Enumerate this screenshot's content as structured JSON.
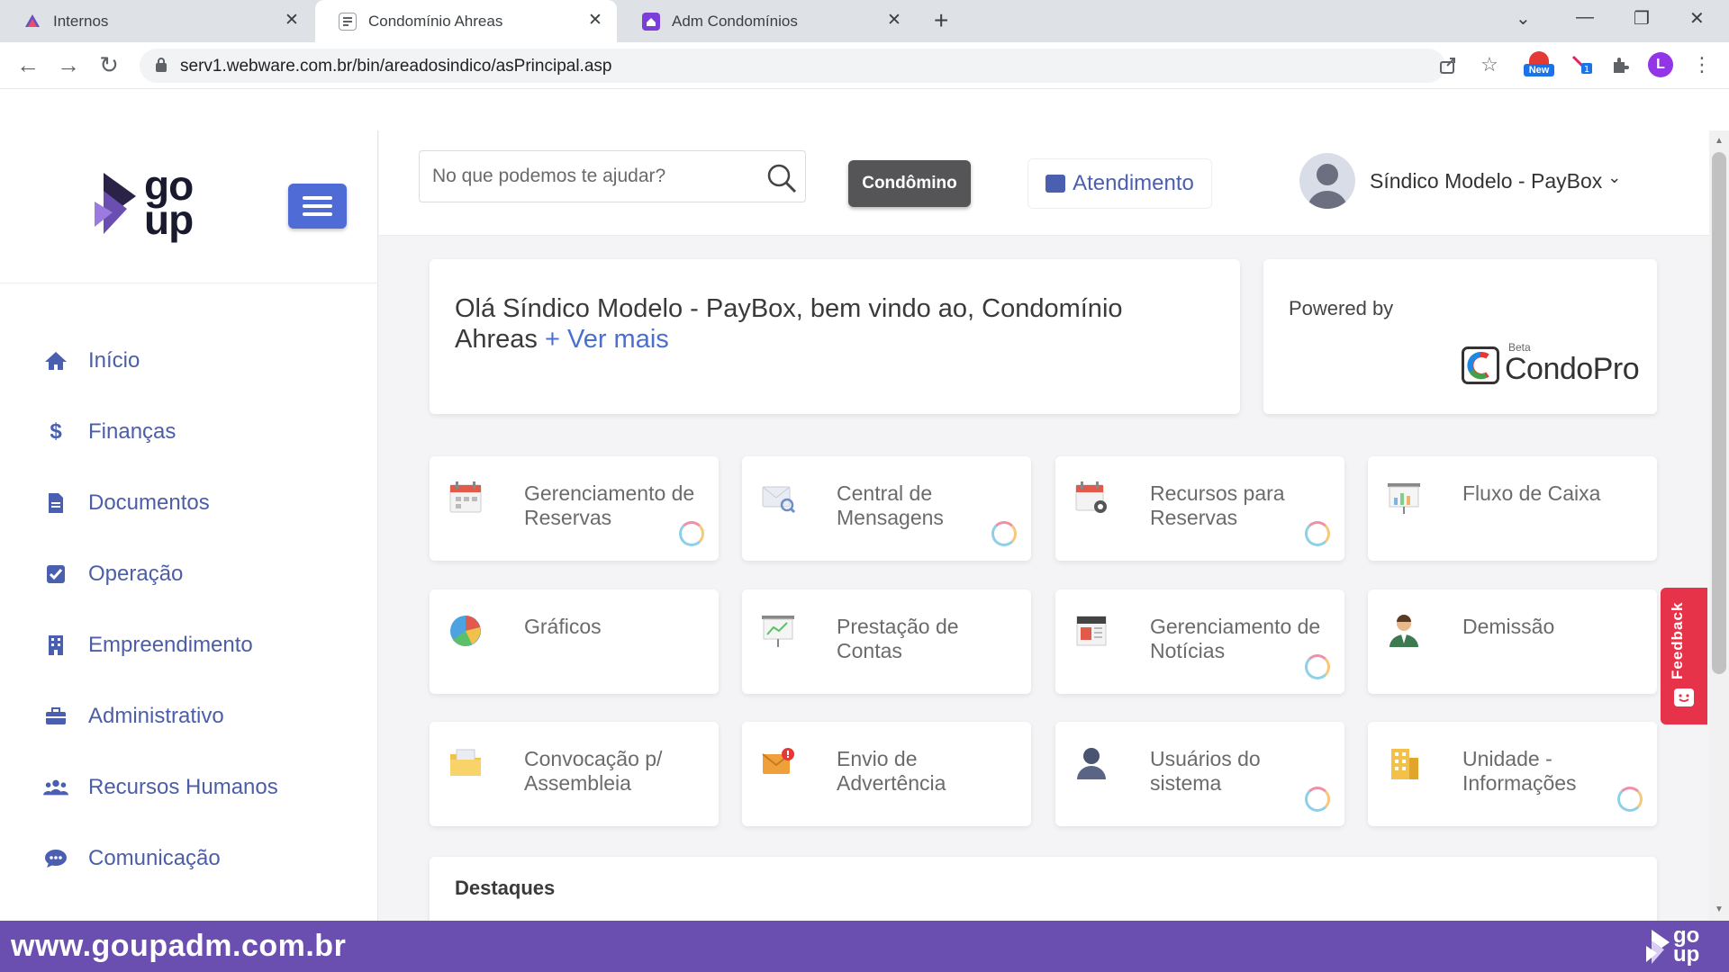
{
  "browser": {
    "tabs": [
      {
        "label": "Internos",
        "active": false
      },
      {
        "label": "Condomínio Ahreas",
        "active": true
      },
      {
        "label": "Adm Condomínios",
        "active": false
      }
    ],
    "url": "serv1.webware.com.br/bin/areadosindico/asPrincipal.asp",
    "badge_new": "New",
    "profile_initial": "L"
  },
  "logo": {
    "line1": "go",
    "line2": "up"
  },
  "sidebar": {
    "items": [
      {
        "label": "Início",
        "icon": "home-icon"
      },
      {
        "label": "Finanças",
        "icon": "dollar-icon"
      },
      {
        "label": "Documentos",
        "icon": "document-icon"
      },
      {
        "label": "Operação",
        "icon": "checkbox-icon"
      },
      {
        "label": "Empreendimento",
        "icon": "building-icon"
      },
      {
        "label": "Administrativo",
        "icon": "briefcase-icon"
      },
      {
        "label": "Recursos Humanos",
        "icon": "users-icon"
      },
      {
        "label": "Comunicação",
        "icon": "chat-icon"
      }
    ]
  },
  "header": {
    "search_placeholder": "No que podemos te ajudar?",
    "condo_button": "Condômino",
    "support_button": "Atendimento",
    "user_name": "Síndico Modelo - PayBox",
    "user_chevron": "⌄"
  },
  "welcome": {
    "text": "Olá Síndico Modelo - PayBox, bem vindo ao, Condomínio Ahreas",
    "link": "+ Ver mais"
  },
  "powered": {
    "label": "Powered by",
    "beta": "Beta",
    "brand": "CondoPro"
  },
  "tiles": [
    {
      "label": "Gerenciamento de Reservas",
      "icon": "calendar-icon",
      "loading": true
    },
    {
      "label": "Central de Mensagens",
      "icon": "message-search-icon",
      "loading": true
    },
    {
      "label": "Recursos para Reservas",
      "icon": "calendar-settings-icon",
      "loading": true
    },
    {
      "label": "Fluxo de Caixa",
      "icon": "cashflow-icon",
      "loading": false
    },
    {
      "label": "Gráficos",
      "icon": "pie-chart-icon",
      "loading": false
    },
    {
      "label": "Prestação de Contas",
      "icon": "presentation-icon",
      "loading": false
    },
    {
      "label": "Gerenciamento de Notícias",
      "icon": "news-icon",
      "loading": true
    },
    {
      "label": "Demissão",
      "icon": "person-icon",
      "loading": false
    },
    {
      "label": "Convocação p/ Assembleia",
      "icon": "folder-icon",
      "loading": false
    },
    {
      "label": "Envio de Advertência",
      "icon": "mail-alert-icon",
      "loading": false
    },
    {
      "label": "Usuários do sistema",
      "icon": "user-icon",
      "loading": true
    },
    {
      "label": "Unidade - Informações",
      "icon": "building-info-icon",
      "loading": true
    }
  ],
  "destaques": {
    "title": "Destaques"
  },
  "feedback": {
    "label": "Feedback"
  },
  "footer": {
    "url": "www.goupadm.com.br",
    "logo_line1": "go",
    "logo_line2": "up"
  }
}
